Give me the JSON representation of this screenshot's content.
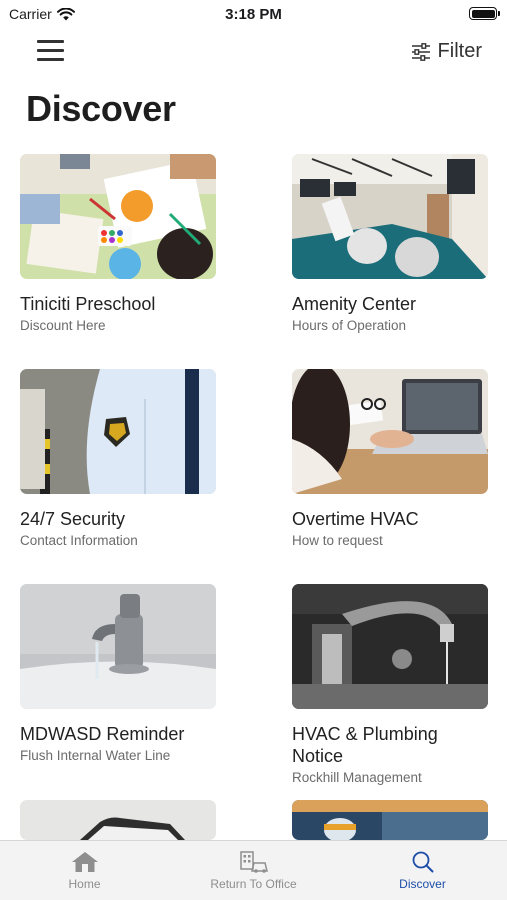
{
  "status_bar": {
    "carrier": "Carrier",
    "time": "3:18 PM"
  },
  "header": {
    "filter_label": "Filter",
    "page_title": "Discover"
  },
  "cards": [
    {
      "title": "Tiniciti Preschool",
      "subtitle": "Discount Here"
    },
    {
      "title": "Amenity Center",
      "subtitle": "Hours of Operation"
    },
    {
      "title": "24/7 Security",
      "subtitle": "Contact Information"
    },
    {
      "title": "Overtime HVAC",
      "subtitle": "How to request"
    },
    {
      "title": "MDWASD Reminder",
      "subtitle": "Flush Internal Water Line"
    },
    {
      "title": "HVAC & Plumbing Notice",
      "subtitle": "Rockhill Management"
    }
  ],
  "tab_bar": {
    "tabs": [
      {
        "label": "Home",
        "icon": "home-icon"
      },
      {
        "label": "Return To Office",
        "icon": "office-icon"
      },
      {
        "label": "Discover",
        "icon": "search-icon"
      }
    ],
    "active_tab": "Discover",
    "active_color": "#1d4ea8"
  }
}
